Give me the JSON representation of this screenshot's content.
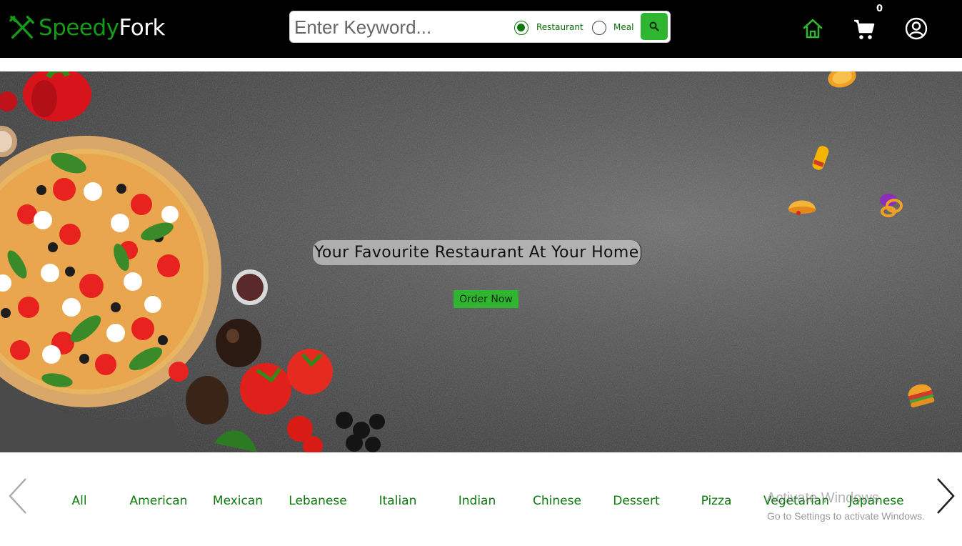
{
  "brand": {
    "name_part1": "Speedy",
    "name_part2": "Fork",
    "logo_icon": "fork-knife-icon",
    "colors": {
      "primary_green": "#169c16",
      "button_green": "#2fb52f",
      "header_bg": "#000000"
    }
  },
  "search": {
    "placeholder": "Enter Keyword...",
    "value": "",
    "options": [
      {
        "label": "Restaurant",
        "checked": true
      },
      {
        "label": "Meal",
        "checked": false
      }
    ],
    "button_icon": "search-icon"
  },
  "nav": {
    "home_icon": "home-icon",
    "cart_icon": "cart-icon",
    "cart_count": "0",
    "profile_icon": "user-circle-icon"
  },
  "hero": {
    "headline": "Your Favourite Restaurant At Your Home",
    "cta_label": "Order Now"
  },
  "categories": {
    "items": [
      "All",
      "American",
      "Mexican",
      "Lebanese",
      "Italian",
      "Indian",
      "Chinese",
      "Dessert",
      "Pizza",
      "Vegetarian",
      "Japanese"
    ],
    "prev_icon": "chevron-left-icon",
    "next_icon": "chevron-right-icon"
  },
  "watermark": {
    "title": "Activate Windows",
    "subtitle": "Go to Settings to activate Windows."
  }
}
